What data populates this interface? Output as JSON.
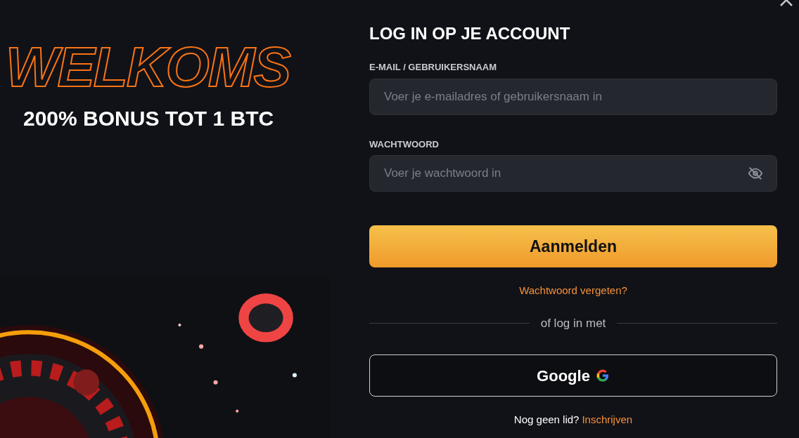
{
  "promo": {
    "headline": "WELKOMS",
    "subline": "200% BONUS TOT 1 BTC"
  },
  "form": {
    "title": "LOG IN OP JE ACCOUNT",
    "fields": [
      {
        "label": "E-MAIL / GEBRUIKERSNAAM",
        "placeholder": "Voer je e-mailadres of gebruikersnaam in",
        "kind": "text"
      },
      {
        "label": "WACHTWOORD",
        "placeholder": "Voer je wachtwoord in",
        "kind": "password"
      }
    ],
    "submit": "Aanmelden",
    "forgot": "Wachtwoord vergeten?",
    "divider": "of log in met",
    "social": "Google",
    "signup": {
      "question": "Nog geen lid?",
      "link": "Inschrijven"
    }
  }
}
